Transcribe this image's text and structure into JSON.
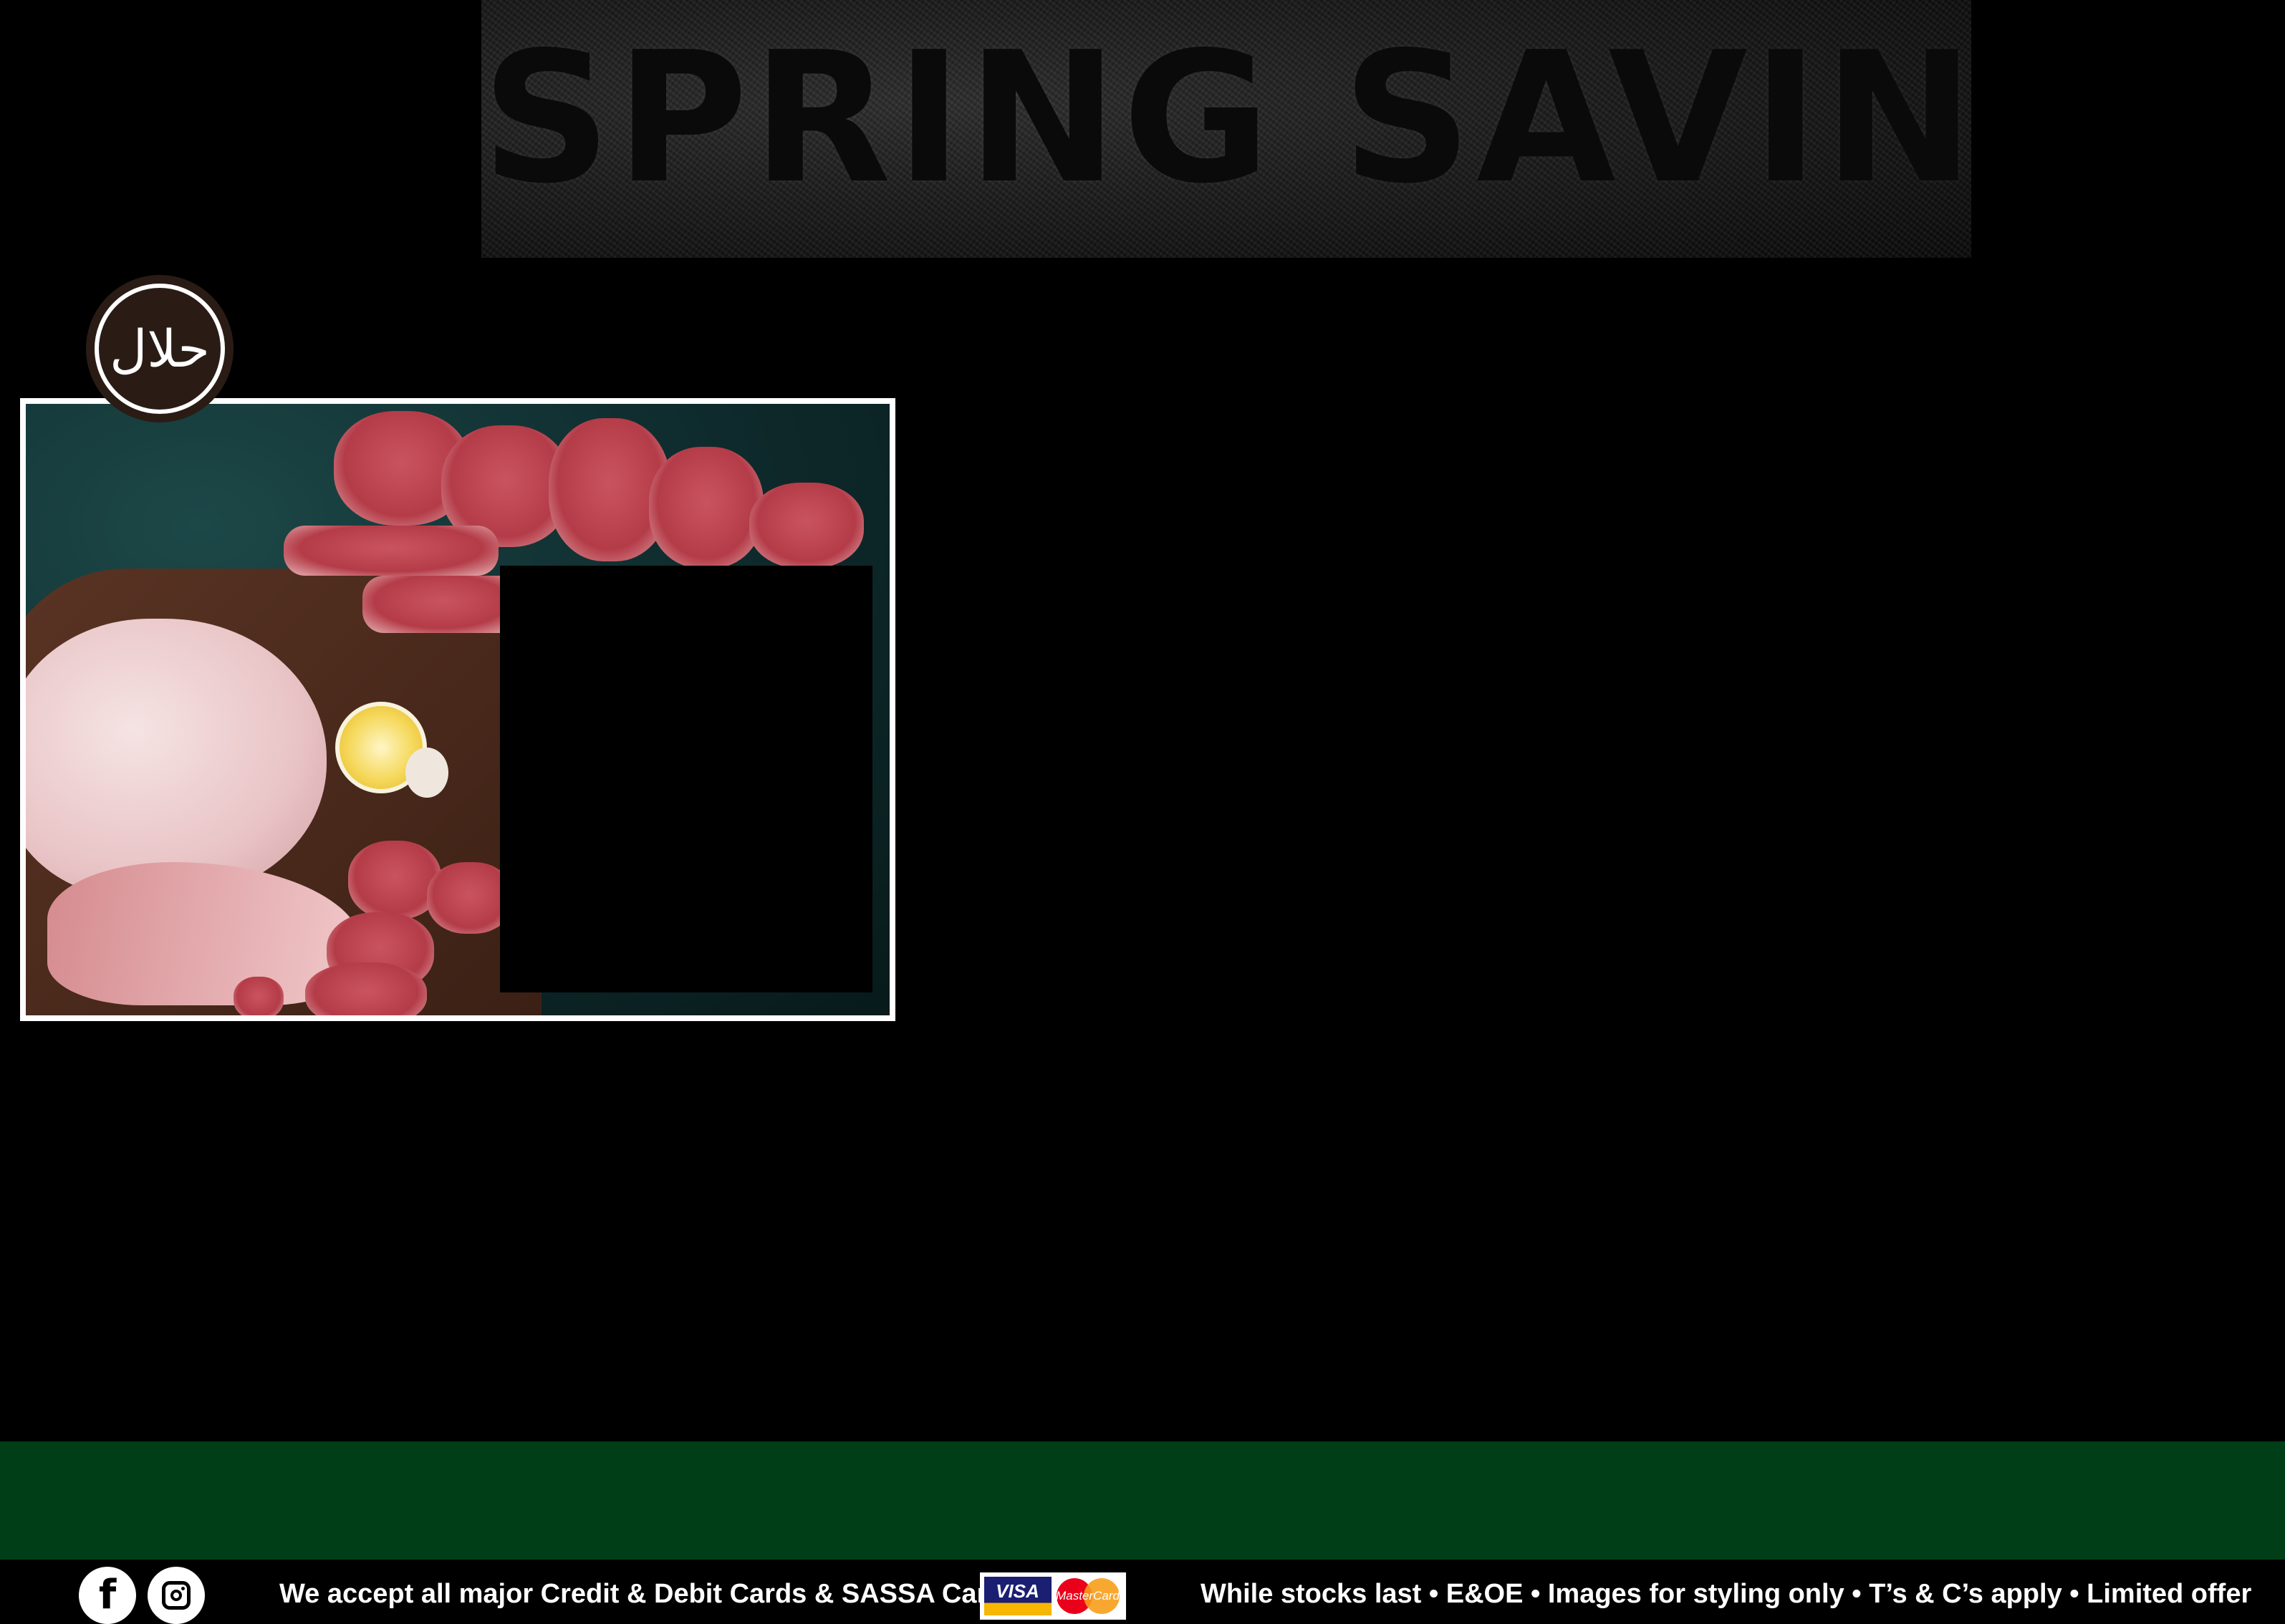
{
  "banner": {
    "title": "SPRING SAVINGS"
  },
  "badge": {
    "halal_text": "حلال"
  },
  "footer": {
    "payment_text": "We accept all major Credit & Debit Cards & SASSA Cards",
    "disclaimer": "While stocks last • E&OE • Images for styling only • T’s & C’s apply • Limited offer",
    "cards": {
      "visa": "VISA",
      "mastercard": "MasterCard"
    }
  },
  "social": {
    "facebook_icon": "facebook-icon",
    "instagram_icon": "instagram-icon"
  },
  "colors": {
    "background": "#000000",
    "footer_band": "#003e18",
    "badge": "#2a1c15",
    "frame": "#ffffff"
  }
}
